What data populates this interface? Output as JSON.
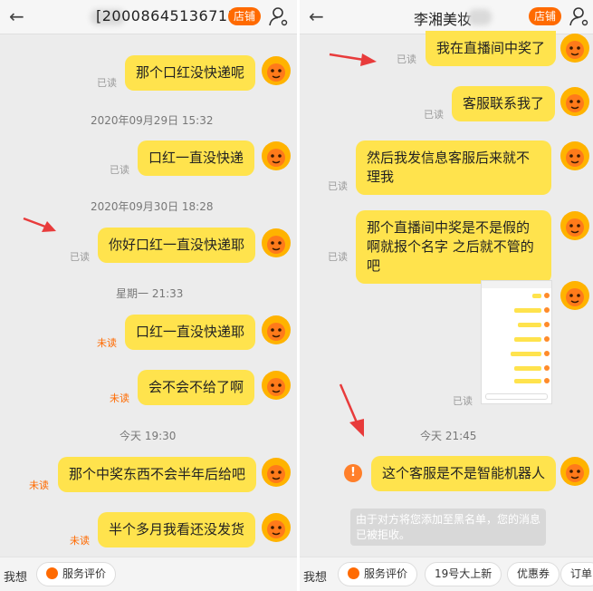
{
  "left": {
    "header": {
      "title": "[20008645136713]",
      "shop_label": "店铺"
    },
    "messages": [
      {
        "text": "那个口红没快递呢",
        "status": "已读"
      },
      {
        "text": "口红一直没快递",
        "status": "已读"
      },
      {
        "text": "你好口红一直没快递耶",
        "status": "已读"
      },
      {
        "text": "口红一直没快递耶",
        "status": "未读"
      },
      {
        "text": "会不会不给了啊",
        "status": "未读"
      },
      {
        "text": "那个中奖东西不会半年后给吧",
        "status": "未读"
      },
      {
        "text": "半个多月我看还没发货",
        "status": "未读"
      }
    ],
    "timestamps": [
      "2020年09月29日 15:32",
      "2020年09月30日 18:28",
      "星期一 21:33",
      "今天 19:30"
    ],
    "footer": {
      "label": "我想",
      "chip": "服务评价"
    }
  },
  "right": {
    "header": {
      "title": "李湘美妆",
      "shop_label": "店铺"
    },
    "messages": [
      {
        "text": "我在直播间中奖了",
        "status": "已读"
      },
      {
        "text": "客服联系我了",
        "status": "已读"
      },
      {
        "text": "然后我发信息客服后来就不理我",
        "status": "已读"
      },
      {
        "text": "那个直播间中奖是不是假的啊就报个名字 之后就不管的吧",
        "status": "已读"
      },
      {
        "text": "这个客服是不是智能机器人",
        "status": ""
      }
    ],
    "image_status": "已读",
    "timestamp": "今天 21:45",
    "system_message": "由于对方将您添加至黑名单，您的消息已被拒收。",
    "warning_symbol": "!",
    "footer": {
      "label": "我想",
      "chips": [
        "服务评价",
        "19号大上新",
        "优惠券",
        "订单"
      ]
    }
  },
  "colors": {
    "bubble": "#ffe34d",
    "accent": "#ff6a00",
    "arrow": "#e83b3b"
  }
}
